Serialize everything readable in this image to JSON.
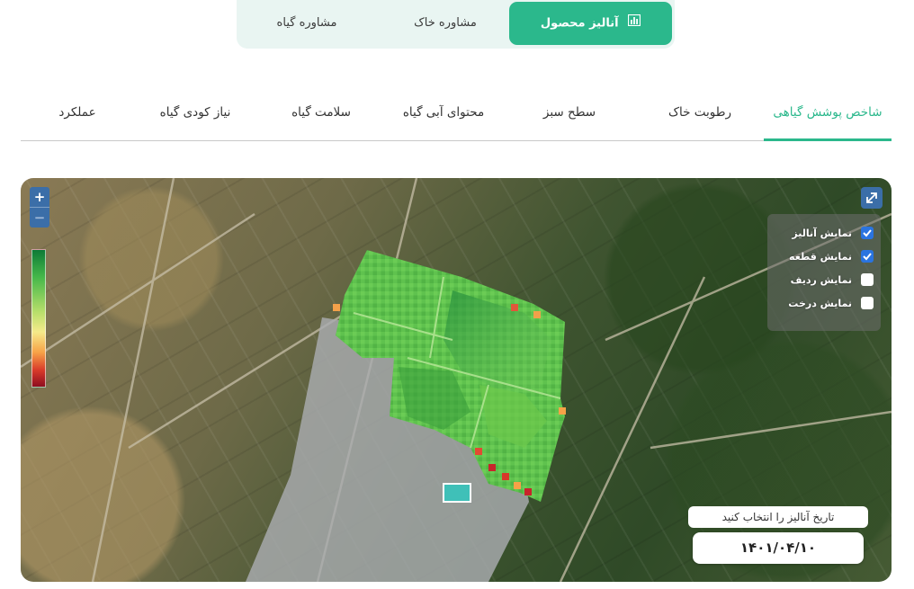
{
  "top_nav": {
    "plant_advice": "مشاوره گیاه",
    "soil_advice": "مشاوره خاک",
    "crop_analysis": "آنالیز محصول"
  },
  "tabs": [
    {
      "label": "شاخص پوشش گیاهی",
      "active": true
    },
    {
      "label": "رطوبت خاک",
      "active": false
    },
    {
      "label": "سطح سبز",
      "active": false
    },
    {
      "label": "محتوای آبی گیاه",
      "active": false
    },
    {
      "label": "سلامت گیاه",
      "active": false
    },
    {
      "label": "نیاز کودی گیاه",
      "active": false
    },
    {
      "label": "عملکرد",
      "active": false
    }
  ],
  "map": {
    "zoom_in": "+",
    "zoom_out": "−",
    "layers": [
      {
        "label": "نمایش آنالیز",
        "checked": true
      },
      {
        "label": "نمایش قطعه",
        "checked": true
      },
      {
        "label": "نمایش ردیف",
        "checked": false
      },
      {
        "label": "نمایش درخت",
        "checked": false
      }
    ],
    "date_prompt": "تاریخ آنالیز را انتخاب کنید",
    "date_value": "۱۴۰۱/۰۴/۱۰",
    "legend_colors": [
      "#0d7a36",
      "#46b84a",
      "#b6de6a",
      "#f5ea8a",
      "#f7a247",
      "#d83a2a",
      "#8e0d1f"
    ]
  },
  "colors": {
    "accent": "#2bb88c",
    "map_control": "#3b6ea8",
    "checkbox_on": "#2a74e0"
  }
}
